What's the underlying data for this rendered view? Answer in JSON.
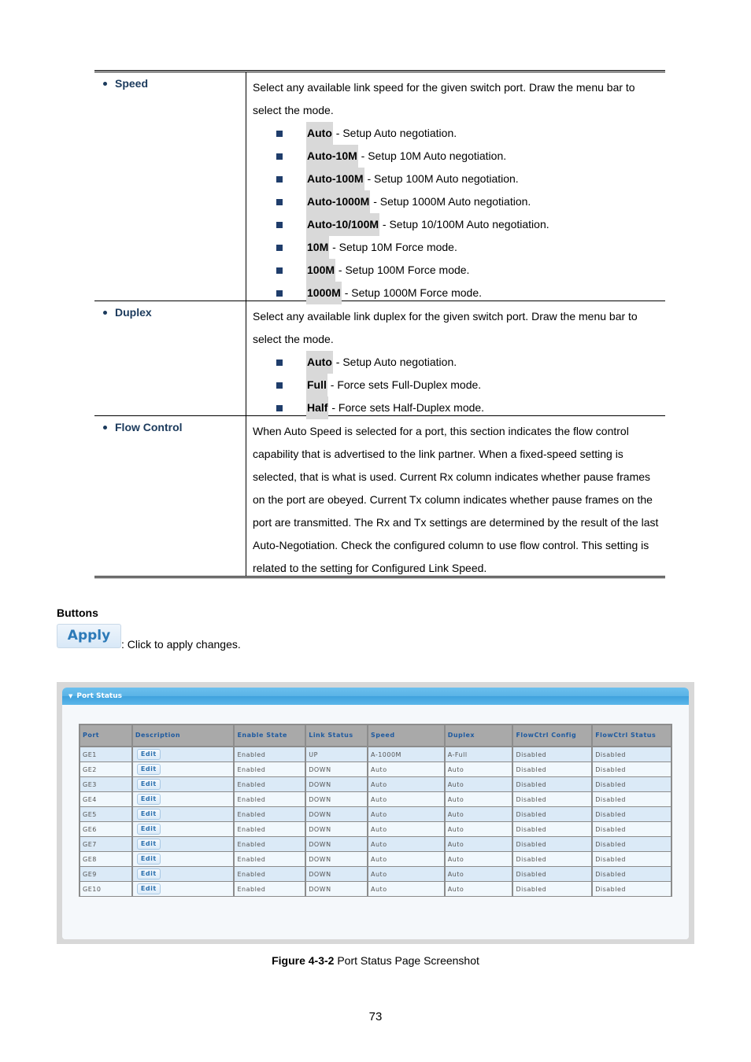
{
  "definitions": [
    {
      "term": "Speed",
      "description": "Select any available link speed for the given switch port. Draw the menu bar to select the mode.",
      "options": [
        {
          "key": "Auto",
          "text": " - Setup Auto negotiation."
        },
        {
          "key": "Auto-10M",
          "text": " - Setup 10M Auto negotiation."
        },
        {
          "key": "Auto-100M",
          "text": " - Setup 100M Auto negotiation."
        },
        {
          "key": "Auto-1000M",
          "text": " - Setup 1000M Auto negotiation."
        },
        {
          "key": "Auto-10/100M",
          "text": " - Setup 10/100M Auto negotiation."
        },
        {
          "key": "10M",
          "text": " - Setup 10M Force mode."
        },
        {
          "key": "100M",
          "text": " - Setup 100M Force mode."
        },
        {
          "key": "1000M",
          "text": " - Setup 1000M Force mode."
        }
      ]
    },
    {
      "term": "Duplex",
      "description": "Select any available link duplex for the given switch port. Draw the menu bar to select the mode.",
      "options": [
        {
          "key": "Auto",
          "text": " - Setup Auto negotiation."
        },
        {
          "key": "Full",
          "text": " - Force sets Full-Duplex mode."
        },
        {
          "key": "Half",
          "text": " - Force sets Half-Duplex mode."
        }
      ]
    },
    {
      "term": "Flow Control",
      "description": "When Auto Speed is selected for a port, this section indicates the flow control capability that is advertised to the link partner. When a fixed-speed setting is selected, that is what is used. Current Rx column indicates whether pause frames on the port are obeyed. Current Tx column indicates whether pause frames on the port are transmitted. The Rx and Tx settings are determined by the result of the last Auto-Negotiation. Check the configured column to use flow control. This setting is related to the setting for Configured Link Speed.",
      "options": []
    }
  ],
  "buttons_section": {
    "heading": "Buttons",
    "apply_label": "Apply",
    "apply_description": ": Click to apply changes."
  },
  "screenshot": {
    "panel_title": "Port Status",
    "arrow_icon": "▼",
    "columns": [
      "Port",
      "Description",
      "Enable State",
      "Link Status",
      "Speed",
      "Duplex",
      "FlowCtrl Config",
      "FlowCtrl Status"
    ],
    "edit_label": "Edit",
    "rows": [
      {
        "port": "GE1",
        "enable": "Enabled",
        "link": "UP",
        "speed": "A-1000M",
        "duplex": "A-Full",
        "fc_config": "Disabled",
        "fc_status": "Disabled"
      },
      {
        "port": "GE2",
        "enable": "Enabled",
        "link": "DOWN",
        "speed": "Auto",
        "duplex": "Auto",
        "fc_config": "Disabled",
        "fc_status": "Disabled"
      },
      {
        "port": "GE3",
        "enable": "Enabled",
        "link": "DOWN",
        "speed": "Auto",
        "duplex": "Auto",
        "fc_config": "Disabled",
        "fc_status": "Disabled"
      },
      {
        "port": "GE4",
        "enable": "Enabled",
        "link": "DOWN",
        "speed": "Auto",
        "duplex": "Auto",
        "fc_config": "Disabled",
        "fc_status": "Disabled"
      },
      {
        "port": "GE5",
        "enable": "Enabled",
        "link": "DOWN",
        "speed": "Auto",
        "duplex": "Auto",
        "fc_config": "Disabled",
        "fc_status": "Disabled"
      },
      {
        "port": "GE6",
        "enable": "Enabled",
        "link": "DOWN",
        "speed": "Auto",
        "duplex": "Auto",
        "fc_config": "Disabled",
        "fc_status": "Disabled"
      },
      {
        "port": "GE7",
        "enable": "Enabled",
        "link": "DOWN",
        "speed": "Auto",
        "duplex": "Auto",
        "fc_config": "Disabled",
        "fc_status": "Disabled"
      },
      {
        "port": "GE8",
        "enable": "Enabled",
        "link": "DOWN",
        "speed": "Auto",
        "duplex": "Auto",
        "fc_config": "Disabled",
        "fc_status": "Disabled"
      },
      {
        "port": "GE9",
        "enable": "Enabled",
        "link": "DOWN",
        "speed": "Auto",
        "duplex": "Auto",
        "fc_config": "Disabled",
        "fc_status": "Disabled"
      },
      {
        "port": "GE10",
        "enable": "Enabled",
        "link": "DOWN",
        "speed": "Auto",
        "duplex": "Auto",
        "fc_config": "Disabled",
        "fc_status": "Disabled"
      }
    ]
  },
  "caption": {
    "label": "Figure 4-3-2",
    "text": " Port Status Page Screenshot"
  },
  "page_number": "73"
}
